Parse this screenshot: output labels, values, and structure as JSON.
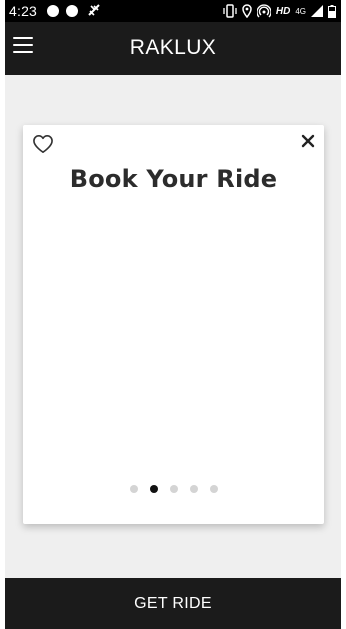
{
  "status_bar": {
    "time": "4:23",
    "hd_label": "HD",
    "network_label": "4G",
    "icons": [
      "notification-dot-icon",
      "notification-dot-icon",
      "no-location-icon",
      "vibrate-icon",
      "location-pin-icon",
      "hotspot-icon",
      "signal-icon",
      "battery-icon"
    ]
  },
  "header": {
    "title": "RAKLUX",
    "menu_icon": "hamburger-menu-icon"
  },
  "card": {
    "title": "Book Your Ride",
    "favorite_icon": "heart-outline-icon",
    "close_icon": "close-icon",
    "pager": {
      "count": 5,
      "active_index": 1
    }
  },
  "footer": {
    "button_label": "GET RIDE"
  },
  "colors": {
    "header_bg": "#1b1b1b",
    "content_bg": "#efefef",
    "card_bg": "#ffffff",
    "active_dot": "#111111",
    "inactive_dot": "#d4d4d4"
  }
}
